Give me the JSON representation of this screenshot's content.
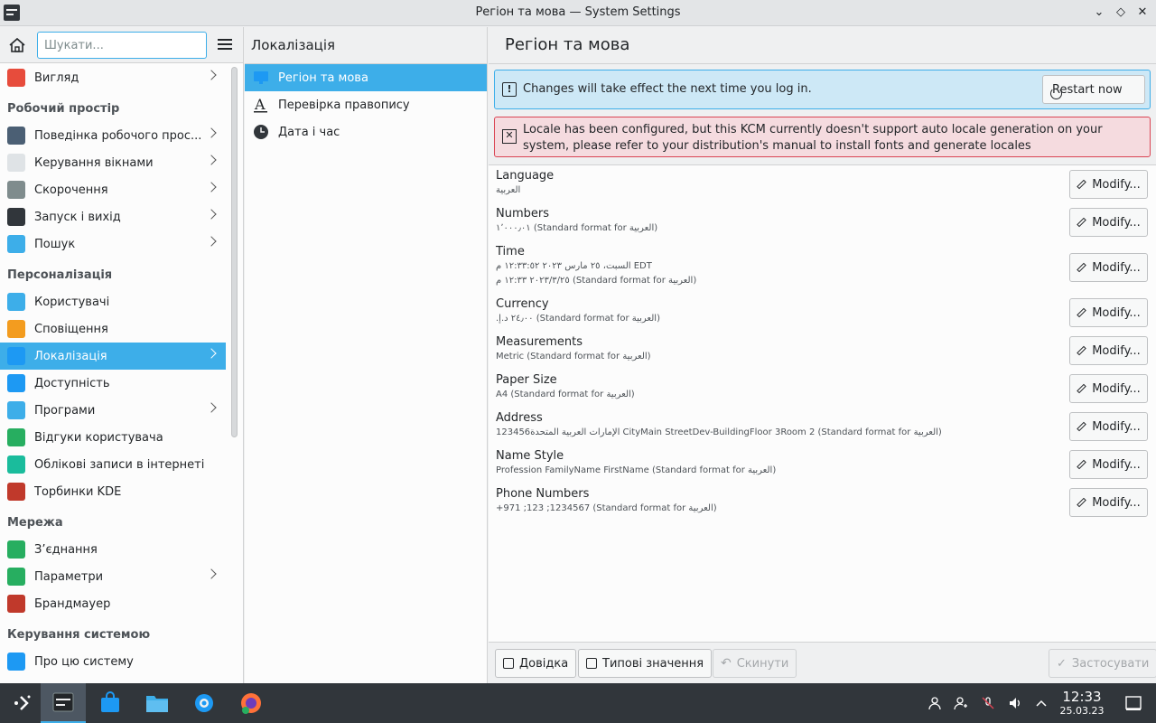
{
  "window": {
    "title": "Регіон та мова — System Settings"
  },
  "sidebar": {
    "search_placeholder": "Шукати...",
    "items": [
      {
        "type": "item",
        "label": "Вигляд",
        "icon": "appearance-icon",
        "color": "#e74c3c",
        "chevron": true
      },
      {
        "type": "header",
        "label": "Робочий простір"
      },
      {
        "type": "item",
        "label": "Поведінка робочого прос...",
        "icon": "workspace-behavior-icon",
        "color": "#4b5f74",
        "chevron": true
      },
      {
        "type": "item",
        "label": "Керування вікнами",
        "icon": "window-management-icon",
        "color": "#dfe3e6",
        "chevron": true
      },
      {
        "type": "item",
        "label": "Скорочення",
        "icon": "keyboard-icon",
        "color": "#7f8c8d",
        "chevron": true
      },
      {
        "type": "item",
        "label": "Запуск і вихід",
        "icon": "startup-icon",
        "color": "#31363b",
        "chevron": true
      },
      {
        "type": "item",
        "label": "Пошук",
        "icon": "search-icon",
        "color": "#3daee9",
        "chevron": true
      },
      {
        "type": "header",
        "label": "Персоналізація"
      },
      {
        "type": "item",
        "label": "Користувачі",
        "icon": "users-icon",
        "color": "#3daee9",
        "chevron": false
      },
      {
        "type": "item",
        "label": "Сповіщення",
        "icon": "bell-icon",
        "color": "#f39c1f",
        "chevron": false
      },
      {
        "type": "item",
        "label": "Локалізація",
        "icon": "localization-icon",
        "color": "#1d99f3",
        "chevron": true,
        "active": true
      },
      {
        "type": "item",
        "label": "Доступність",
        "icon": "accessibility-icon",
        "color": "#1d99f3",
        "chevron": false
      },
      {
        "type": "item",
        "label": "Програми",
        "icon": "applications-icon",
        "color": "#3daee9",
        "chevron": true
      },
      {
        "type": "item",
        "label": "Відгуки користувача",
        "icon": "feedback-icon",
        "color": "#27ae60",
        "chevron": false
      },
      {
        "type": "item",
        "label": "Облікові записи в інтернеті",
        "icon": "online-accounts-icon",
        "color": "#1abc9c",
        "chevron": false
      },
      {
        "type": "item",
        "label": "Торбинки KDE",
        "icon": "wallet-icon",
        "color": "#c0392b",
        "chevron": false
      },
      {
        "type": "header",
        "label": "Мережа"
      },
      {
        "type": "item",
        "label": "З’єднання",
        "icon": "globe-icon",
        "color": "#27ae60",
        "chevron": false
      },
      {
        "type": "item",
        "label": "Параметри",
        "icon": "network-settings-icon",
        "color": "#27ae60",
        "chevron": true
      },
      {
        "type": "item",
        "label": "Брандмауер",
        "icon": "firewall-icon",
        "color": "#c0392b",
        "chevron": false
      },
      {
        "type": "header",
        "label": "Керування системою"
      },
      {
        "type": "item",
        "label": "Про цю систему",
        "icon": "about-icon",
        "color": "#1d99f3",
        "chevron": false
      }
    ]
  },
  "middle": {
    "title": "Локалізація",
    "items": [
      {
        "label": "Регіон та мова",
        "icon": "region-language-icon",
        "active": true
      },
      {
        "label": "Перевірка правопису",
        "icon": "spellcheck-icon",
        "active": false
      },
      {
        "label": "Дата і час",
        "icon": "clock-icon",
        "active": false
      }
    ]
  },
  "content": {
    "title": "Регіон та мова",
    "info_message": "Changes will take effect the next time you log in.",
    "restart_label": "Restart now",
    "error_message": "Locale has been configured, but this KCM currently doesn't support auto locale generation on your system, please refer to your distribution's manual to install fonts and generate locales",
    "modify_label": "Modify...",
    "rows": [
      {
        "title": "Language",
        "values": [
          "العربية"
        ]
      },
      {
        "title": "Numbers",
        "values": [
          "١٬٠٠٠٫٠١ (Standard format for العربية)"
        ]
      },
      {
        "title": "Time",
        "values": [
          "السبت، ٢٥ مارس ٢٠٢٣ ١٢:٣٣:٥٢ م EDT",
          "٢٠٢٣/٣/٢٥ ١٢:٣٣ م (Standard format for العربية)"
        ]
      },
      {
        "title": "Currency",
        "values": [
          "٢٤٫٠٠ د.إ.‏ (Standard format for العربية)"
        ]
      },
      {
        "title": "Measurements",
        "values": [
          "Metric (Standard format for العربية)"
        ]
      },
      {
        "title": "Paper Size",
        "values": [
          "A4 (Standard format for العربية)"
        ]
      },
      {
        "title": "Address",
        "values": [
          "123456الإمارات العربية المتحدة CityMain StreetDev-BuildingFloor 3Room 2 (Standard format for العربية)"
        ]
      },
      {
        "title": "Name Style",
        "values": [
          "Profession FamilyName FirstName (Standard format for العربية)"
        ]
      },
      {
        "title": "Phone Numbers",
        "values": [
          "+971 ;123 ;1234567 (Standard format for العربية)"
        ]
      }
    ]
  },
  "footer": {
    "help_label": "Довідка",
    "defaults_label": "Типові значення",
    "reset_label": "Скинути",
    "apply_label": "Застосувати"
  },
  "taskbar": {
    "time": "12:33",
    "date": "25.03.23"
  },
  "colors": {
    "accent": "#3daee9",
    "error": "#da4453",
    "taskbar": "#31363b"
  }
}
